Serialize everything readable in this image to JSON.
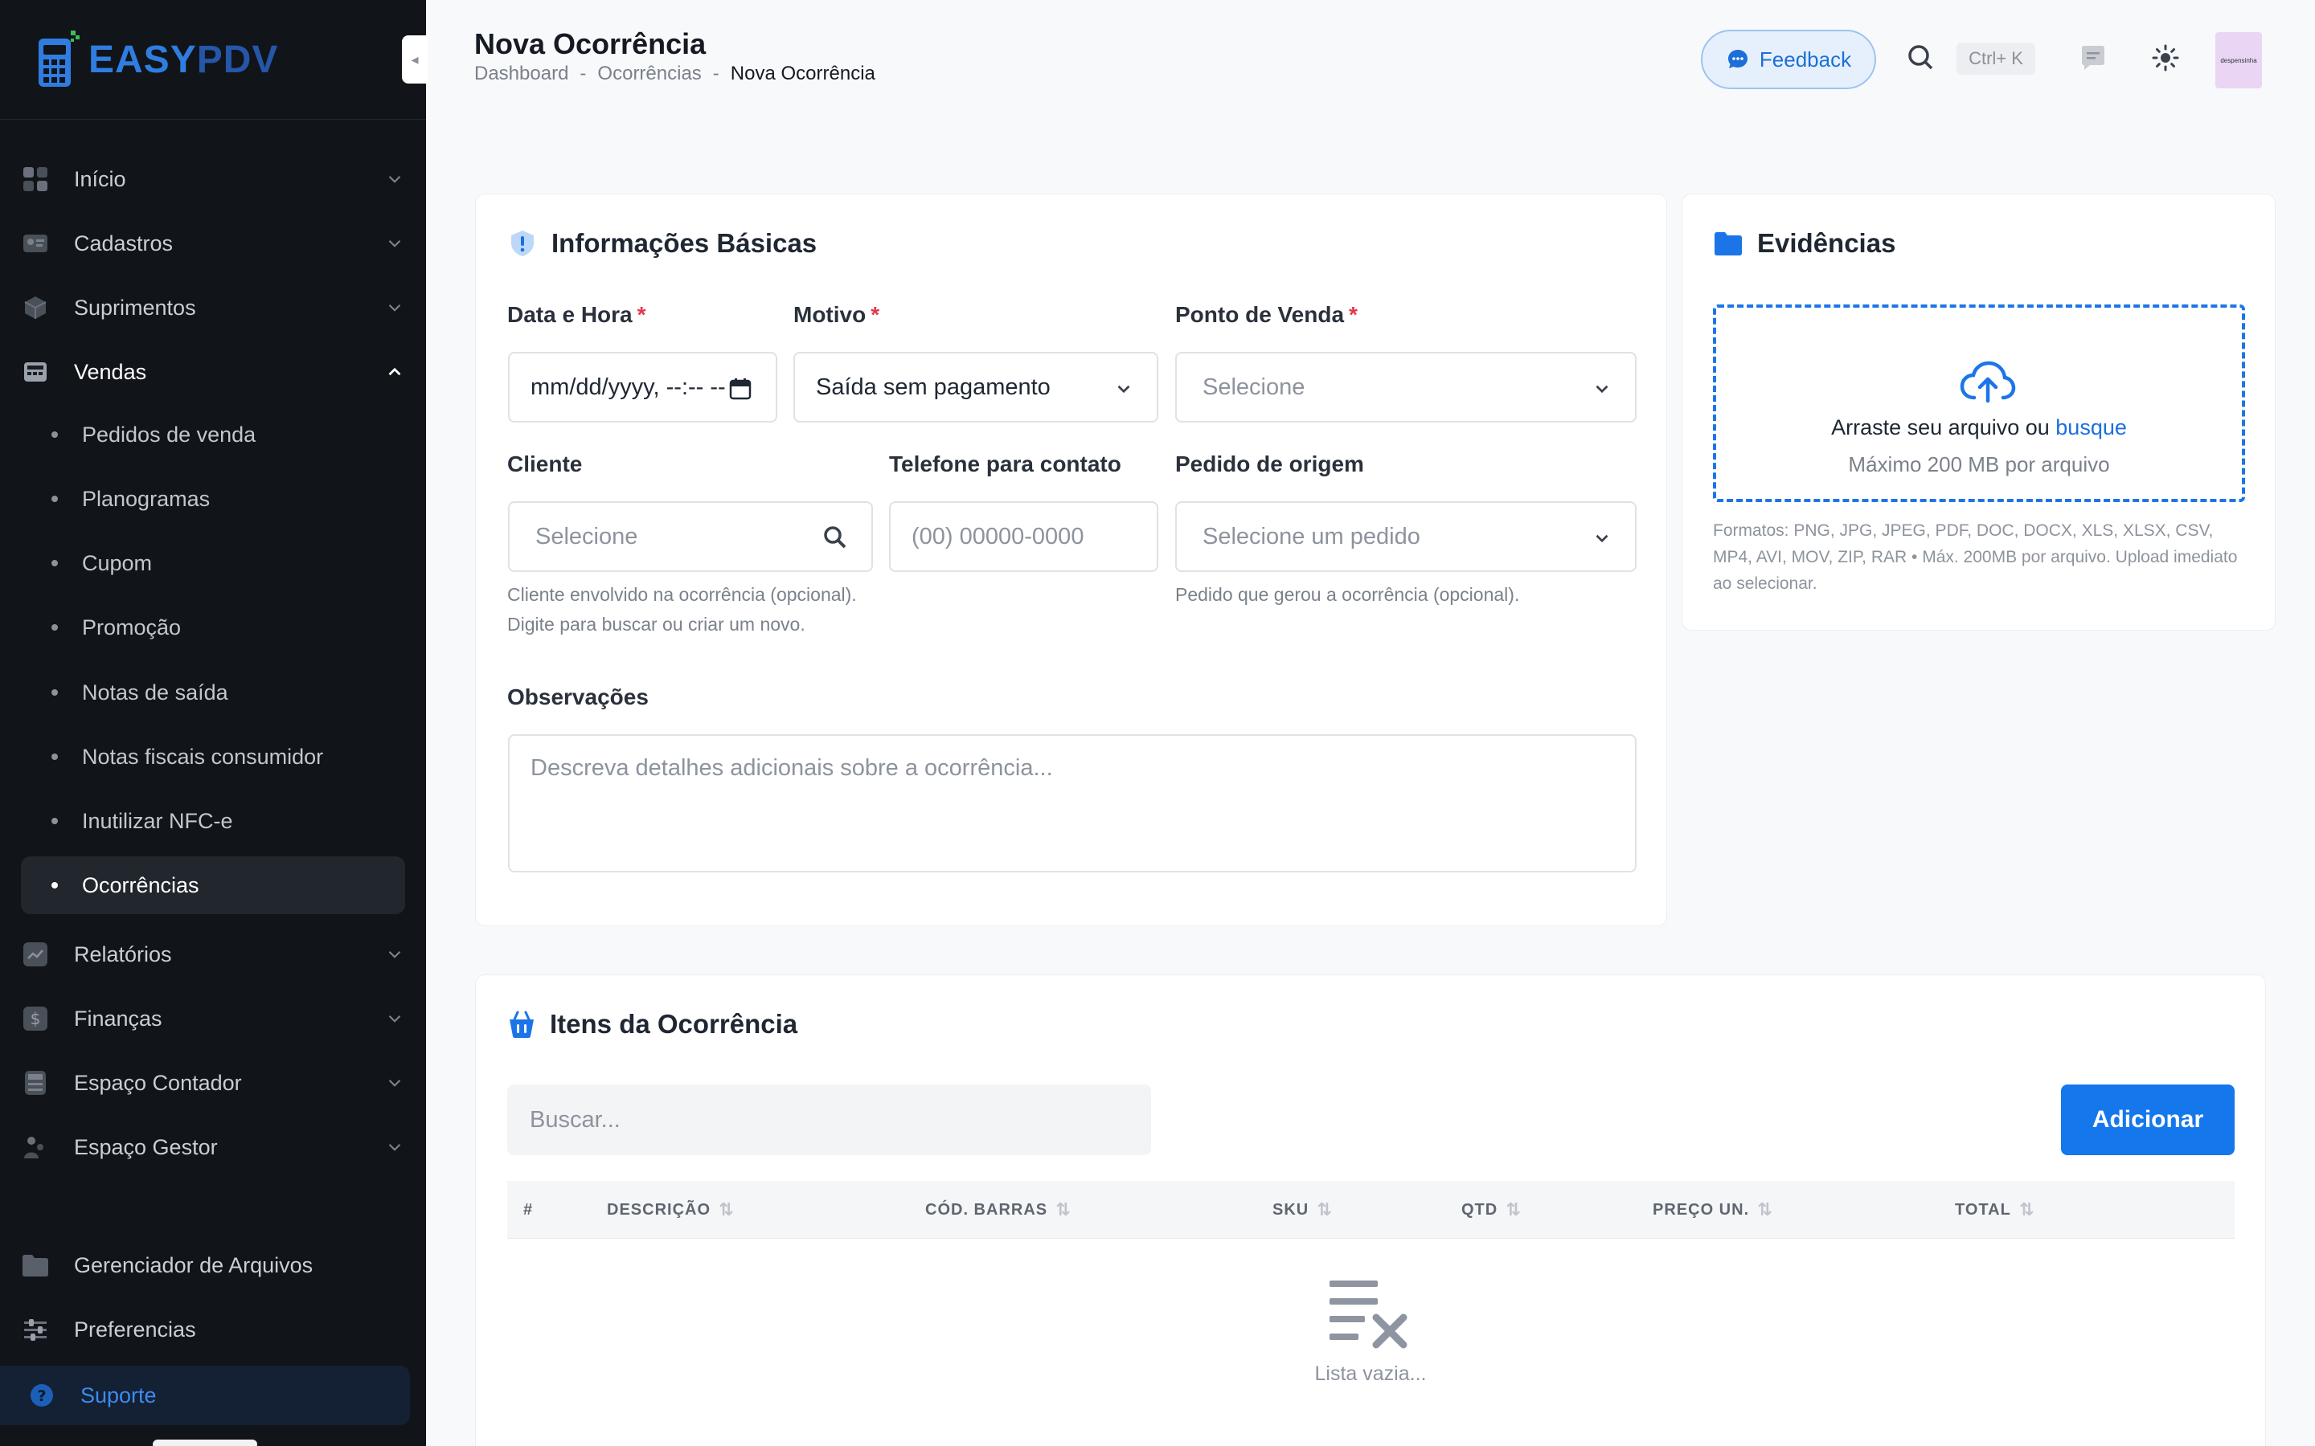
{
  "brand": {
    "logo_text_a": "EASY",
    "logo_text_b": "PDV"
  },
  "sidebar": {
    "items": [
      {
        "label": "Início",
        "icon": "grid-icon"
      },
      {
        "label": "Cadastros",
        "icon": "id-card-icon"
      },
      {
        "label": "Suprimentos",
        "icon": "box-icon"
      },
      {
        "label": "Vendas",
        "icon": "register-icon"
      },
      {
        "label": "Relatórios",
        "icon": "chart-icon"
      },
      {
        "label": "Finanças",
        "icon": "dollar-icon"
      },
      {
        "label": "Espaço Contador",
        "icon": "calculator-icon"
      },
      {
        "label": "Espaço Gestor",
        "icon": "users-icon"
      },
      {
        "label": "Gerenciador de Arquivos",
        "icon": "folder-icon"
      },
      {
        "label": "Preferencias",
        "icon": "sliders-icon"
      },
      {
        "label": "Suporte",
        "icon": "help-icon"
      }
    ],
    "vendas_sub": [
      {
        "label": "Pedidos de venda"
      },
      {
        "label": "Planogramas"
      },
      {
        "label": "Cupom"
      },
      {
        "label": "Promoção"
      },
      {
        "label": "Notas de saída"
      },
      {
        "label": "Notas fiscais consumidor"
      },
      {
        "label": "Inutilizar NFC-e"
      },
      {
        "label": "Ocorrências"
      }
    ]
  },
  "header": {
    "title": "Nova Ocorrência",
    "breadcrumb": [
      "Dashboard",
      "Ocorrências",
      "Nova Ocorrência"
    ],
    "breadcrumb_sep": "-",
    "feedback_label": "Feedback",
    "shortcut": "Ctrl+ K",
    "avatar_text": "despensinha"
  },
  "basic_info": {
    "title": "Informações Básicas",
    "required_mark": "*",
    "datetime": {
      "label": "Data e Hora",
      "value": "mm/dd/yyyy, --:-- --"
    },
    "motivo": {
      "label": "Motivo",
      "value": "Saída sem pagamento"
    },
    "ponto_venda": {
      "label": "Ponto de Venda",
      "placeholder": "Selecione"
    },
    "cliente": {
      "label": "Cliente",
      "placeholder": "Selecione",
      "help": "Cliente envolvido na ocorrência (opcional). Digite para buscar ou criar um novo."
    },
    "telefone": {
      "label": "Telefone para contato",
      "placeholder": "(00) 00000-0000"
    },
    "pedido_origem": {
      "label": "Pedido de origem",
      "placeholder": "Selecione um pedido",
      "help": "Pedido que gerou a ocorrência (opcional)."
    },
    "observacoes": {
      "label": "Observações",
      "placeholder": "Descreva detalhes adicionais sobre a ocorrência..."
    }
  },
  "evidencias": {
    "title": "Evidências",
    "drop_text": "Arraste seu arquivo ou",
    "drop_link": "busque",
    "drop_sub": "Máximo 200 MB por arquivo",
    "formats": "Formatos: PNG, JPG, JPEG, PDF, DOC, DOCX, XLS, XLSX, CSV, MP4, AVI, MOV, ZIP, RAR • Máx. 200MB por arquivo. Upload imediato ao selecionar."
  },
  "items": {
    "title": "Itens da Ocorrência",
    "search_placeholder": "Buscar...",
    "add_label": "Adicionar",
    "columns": [
      "#",
      "DESCRIÇÃO",
      "CÓD. BARRAS",
      "SKU",
      "QTD",
      "PREÇO UN.",
      "TOTAL"
    ],
    "empty_text": "Lista vazia..."
  },
  "colors": {
    "accent": "#1477ec",
    "sidebar_bg": "#111418",
    "required": "#e5374c"
  }
}
